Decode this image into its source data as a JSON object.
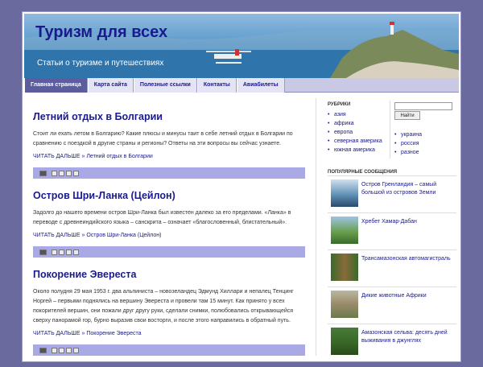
{
  "header": {
    "title": "Туризм для всех",
    "description": "Статьи о туризме и путешествиях"
  },
  "nav": {
    "items": [
      {
        "label": "Главная страница",
        "active": true
      },
      {
        "label": "Карта сайта",
        "active": false
      },
      {
        "label": "Полезные ссылки",
        "active": false
      },
      {
        "label": "Контакты",
        "active": false
      },
      {
        "label": "Авиабилеты",
        "active": false
      }
    ]
  },
  "posts": [
    {
      "title": "Летний отдых в Болгарии",
      "body": "Стоит ли ехать летом в Болгарию? Какие плюсы и минусы таит в себе летний отдых в Болгарии по сравнению с поездкой в другие страны и регионы? Ответы на эти вопросы вы сейчас узнаете.",
      "read_more": "ЧИТАТЬ ДАЛЬШЕ »",
      "read_more_title": "Летний отдых в Болгарии"
    },
    {
      "title": "Остров Шри-Ланка (Цейлон)",
      "body": "Задолго до нашего времени остров Шри-Ланка был известен далеко за его пределами. «Ланка» в переводе с древнеиндийского языка – санскрита – означает «благословенный, блистательный».",
      "read_more": "ЧИТАТЬ ДАЛЬШЕ »",
      "read_more_title": "Остров Шри-Ланка (Цейлон)"
    },
    {
      "title": "Покорение Эвереста",
      "body": "Около полудня 29 мая 1953 г. два альпиниста – новозеландец Эдмунд Хиллари и непалец Тенцинг Норгей – первыми поднялись на вершину Эвереста и провели там 15 минут. Как принято у всех покорителей вершин, они пожали друг другу руки, сделали снимки, полюбовались открывающейся сверху панорамой гор, бурно выразив свои восторги, и после этого направились в обратный путь.",
      "read_more": "ЧИТАТЬ ДАЛЬШЕ »",
      "read_more_title": "Покорение Эвереста"
    }
  ],
  "sidebar": {
    "categories_title": "РУБРИКИ",
    "categories_left": [
      "азия",
      "африка",
      "европа",
      "северная америка",
      "южная америка"
    ],
    "categories_right": [
      "украина",
      "россия",
      "разное"
    ],
    "search_button": "Найти",
    "popular_title": "ПОПУЛЯРНЫЕ СООБЩЕНИЯ",
    "popular": [
      {
        "label": "Остров Гренландия – самый большой из островов Земли",
        "color": "#5a8ab0"
      },
      {
        "label": "Хребет Хамар-Дабан",
        "color": "#6aa050"
      },
      {
        "label": "Трансамазонская автомагистраль",
        "color": "#8a6a3a"
      },
      {
        "label": "Дикие животные Африки",
        "color": "#9a8a6a"
      },
      {
        "label": "Амазонская сельва: десять дней выживания в джунглях",
        "color": "#3a6a2a"
      }
    ]
  },
  "colors": {
    "link": "#1a1a8c",
    "background": "#6a6a9e",
    "share_bar": "#a9a9e6"
  }
}
